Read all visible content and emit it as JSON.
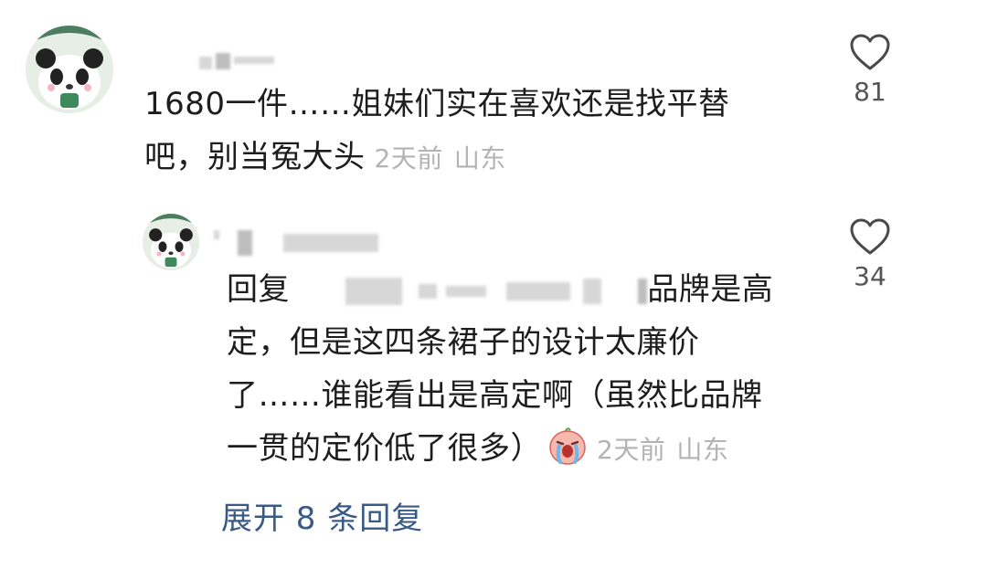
{
  "comment": {
    "text_line1": "1680一件……姐妹们实在喜欢还是找平替",
    "text_line2": "吧，别当冤大头",
    "time": "2天前",
    "location": "山东",
    "likes": "81"
  },
  "reply": {
    "prefix": "回复",
    "line1_tail": "品牌是高",
    "line2": "定，但是这四条裙子的设计太廉价",
    "line3": "了……谁能看出是高定啊（虽然比品牌",
    "line4": "一贯的定价低了很多）",
    "time": "2天前",
    "location": "山东",
    "likes": "34"
  },
  "expand_label": "展开 8 条回复",
  "icons": {
    "like": "heart-outline-icon",
    "emoji": "crying-face-emoji-icon"
  },
  "colors": {
    "meta": "#b3b3b3",
    "link": "#3a5a86",
    "text": "#1d1d1d"
  }
}
